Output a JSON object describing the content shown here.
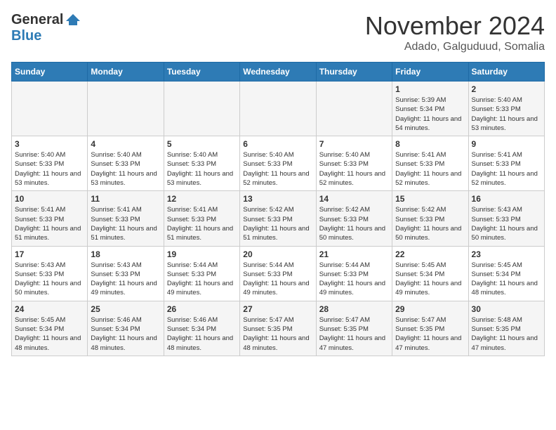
{
  "header": {
    "logo": {
      "general": "General",
      "blue": "Blue"
    },
    "title": "November 2024",
    "location": "Adado, Galguduud, Somalia"
  },
  "calendar": {
    "days_of_week": [
      "Sunday",
      "Monday",
      "Tuesday",
      "Wednesday",
      "Thursday",
      "Friday",
      "Saturday"
    ],
    "weeks": [
      [
        {
          "date": "",
          "sunrise": "",
          "sunset": "",
          "daylight": ""
        },
        {
          "date": "",
          "sunrise": "",
          "sunset": "",
          "daylight": ""
        },
        {
          "date": "",
          "sunrise": "",
          "sunset": "",
          "daylight": ""
        },
        {
          "date": "",
          "sunrise": "",
          "sunset": "",
          "daylight": ""
        },
        {
          "date": "",
          "sunrise": "",
          "sunset": "",
          "daylight": ""
        },
        {
          "date": "1",
          "sunrise": "Sunrise: 5:39 AM",
          "sunset": "Sunset: 5:34 PM",
          "daylight": "Daylight: 11 hours and 54 minutes."
        },
        {
          "date": "2",
          "sunrise": "Sunrise: 5:40 AM",
          "sunset": "Sunset: 5:33 PM",
          "daylight": "Daylight: 11 hours and 53 minutes."
        }
      ],
      [
        {
          "date": "3",
          "sunrise": "Sunrise: 5:40 AM",
          "sunset": "Sunset: 5:33 PM",
          "daylight": "Daylight: 11 hours and 53 minutes."
        },
        {
          "date": "4",
          "sunrise": "Sunrise: 5:40 AM",
          "sunset": "Sunset: 5:33 PM",
          "daylight": "Daylight: 11 hours and 53 minutes."
        },
        {
          "date": "5",
          "sunrise": "Sunrise: 5:40 AM",
          "sunset": "Sunset: 5:33 PM",
          "daylight": "Daylight: 11 hours and 53 minutes."
        },
        {
          "date": "6",
          "sunrise": "Sunrise: 5:40 AM",
          "sunset": "Sunset: 5:33 PM",
          "daylight": "Daylight: 11 hours and 52 minutes."
        },
        {
          "date": "7",
          "sunrise": "Sunrise: 5:40 AM",
          "sunset": "Sunset: 5:33 PM",
          "daylight": "Daylight: 11 hours and 52 minutes."
        },
        {
          "date": "8",
          "sunrise": "Sunrise: 5:41 AM",
          "sunset": "Sunset: 5:33 PM",
          "daylight": "Daylight: 11 hours and 52 minutes."
        },
        {
          "date": "9",
          "sunrise": "Sunrise: 5:41 AM",
          "sunset": "Sunset: 5:33 PM",
          "daylight": "Daylight: 11 hours and 52 minutes."
        }
      ],
      [
        {
          "date": "10",
          "sunrise": "Sunrise: 5:41 AM",
          "sunset": "Sunset: 5:33 PM",
          "daylight": "Daylight: 11 hours and 51 minutes."
        },
        {
          "date": "11",
          "sunrise": "Sunrise: 5:41 AM",
          "sunset": "Sunset: 5:33 PM",
          "daylight": "Daylight: 11 hours and 51 minutes."
        },
        {
          "date": "12",
          "sunrise": "Sunrise: 5:41 AM",
          "sunset": "Sunset: 5:33 PM",
          "daylight": "Daylight: 11 hours and 51 minutes."
        },
        {
          "date": "13",
          "sunrise": "Sunrise: 5:42 AM",
          "sunset": "Sunset: 5:33 PM",
          "daylight": "Daylight: 11 hours and 51 minutes."
        },
        {
          "date": "14",
          "sunrise": "Sunrise: 5:42 AM",
          "sunset": "Sunset: 5:33 PM",
          "daylight": "Daylight: 11 hours and 50 minutes."
        },
        {
          "date": "15",
          "sunrise": "Sunrise: 5:42 AM",
          "sunset": "Sunset: 5:33 PM",
          "daylight": "Daylight: 11 hours and 50 minutes."
        },
        {
          "date": "16",
          "sunrise": "Sunrise: 5:43 AM",
          "sunset": "Sunset: 5:33 PM",
          "daylight": "Daylight: 11 hours and 50 minutes."
        }
      ],
      [
        {
          "date": "17",
          "sunrise": "Sunrise: 5:43 AM",
          "sunset": "Sunset: 5:33 PM",
          "daylight": "Daylight: 11 hours and 50 minutes."
        },
        {
          "date": "18",
          "sunrise": "Sunrise: 5:43 AM",
          "sunset": "Sunset: 5:33 PM",
          "daylight": "Daylight: 11 hours and 49 minutes."
        },
        {
          "date": "19",
          "sunrise": "Sunrise: 5:44 AM",
          "sunset": "Sunset: 5:33 PM",
          "daylight": "Daylight: 11 hours and 49 minutes."
        },
        {
          "date": "20",
          "sunrise": "Sunrise: 5:44 AM",
          "sunset": "Sunset: 5:33 PM",
          "daylight": "Daylight: 11 hours and 49 minutes."
        },
        {
          "date": "21",
          "sunrise": "Sunrise: 5:44 AM",
          "sunset": "Sunset: 5:33 PM",
          "daylight": "Daylight: 11 hours and 49 minutes."
        },
        {
          "date": "22",
          "sunrise": "Sunrise: 5:45 AM",
          "sunset": "Sunset: 5:34 PM",
          "daylight": "Daylight: 11 hours and 49 minutes."
        },
        {
          "date": "23",
          "sunrise": "Sunrise: 5:45 AM",
          "sunset": "Sunset: 5:34 PM",
          "daylight": "Daylight: 11 hours and 48 minutes."
        }
      ],
      [
        {
          "date": "24",
          "sunrise": "Sunrise: 5:45 AM",
          "sunset": "Sunset: 5:34 PM",
          "daylight": "Daylight: 11 hours and 48 minutes."
        },
        {
          "date": "25",
          "sunrise": "Sunrise: 5:46 AM",
          "sunset": "Sunset: 5:34 PM",
          "daylight": "Daylight: 11 hours and 48 minutes."
        },
        {
          "date": "26",
          "sunrise": "Sunrise: 5:46 AM",
          "sunset": "Sunset: 5:34 PM",
          "daylight": "Daylight: 11 hours and 48 minutes."
        },
        {
          "date": "27",
          "sunrise": "Sunrise: 5:47 AM",
          "sunset": "Sunset: 5:35 PM",
          "daylight": "Daylight: 11 hours and 48 minutes."
        },
        {
          "date": "28",
          "sunrise": "Sunrise: 5:47 AM",
          "sunset": "Sunset: 5:35 PM",
          "daylight": "Daylight: 11 hours and 47 minutes."
        },
        {
          "date": "29",
          "sunrise": "Sunrise: 5:47 AM",
          "sunset": "Sunset: 5:35 PM",
          "daylight": "Daylight: 11 hours and 47 minutes."
        },
        {
          "date": "30",
          "sunrise": "Sunrise: 5:48 AM",
          "sunset": "Sunset: 5:35 PM",
          "daylight": "Daylight: 11 hours and 47 minutes."
        }
      ]
    ]
  }
}
